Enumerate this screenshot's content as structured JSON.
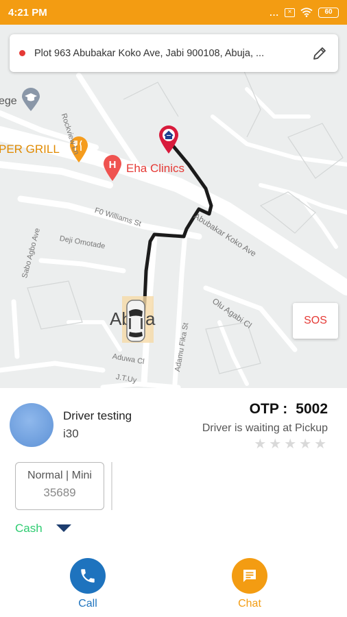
{
  "status_bar": {
    "time": "4:21 PM",
    "dots": "...",
    "battery": "60"
  },
  "search": {
    "address": "Plot 963 Abubakar Koko Ave, Jabi 900108, Abuja, ..."
  },
  "map": {
    "places": [
      {
        "name": "ege"
      },
      {
        "name": "PER GRILL"
      },
      {
        "name": "Eha Clinics"
      }
    ],
    "roads": [
      "Rockview Ln",
      "F0 Williams St",
      "Abubakar Koko Ave",
      "Deji Omotade",
      "Sabo Agbo Ave",
      "Olu Agabi Cl",
      "Adamu Fika St",
      "Aduwa Cl",
      "J.T.Uy"
    ],
    "area_label": "Abuja",
    "sos_label": "SOS"
  },
  "driver": {
    "name": "Driver testing",
    "vehicle": "i30",
    "otp_label": "OTP :",
    "otp_value": "5002",
    "status": "Driver is waiting at Pickup",
    "rating": 0,
    "rating_max": 5,
    "vehicle_type": "Normal | Mini",
    "vehicle_number": "35689",
    "payment_method": "Cash"
  },
  "actions": {
    "call_label": "Call",
    "chat_label": "Chat"
  },
  "colors": {
    "accent_orange": "#f39c12",
    "call_blue": "#1e73be",
    "sos_red": "#e53935",
    "cash_green": "#2ecc71"
  }
}
